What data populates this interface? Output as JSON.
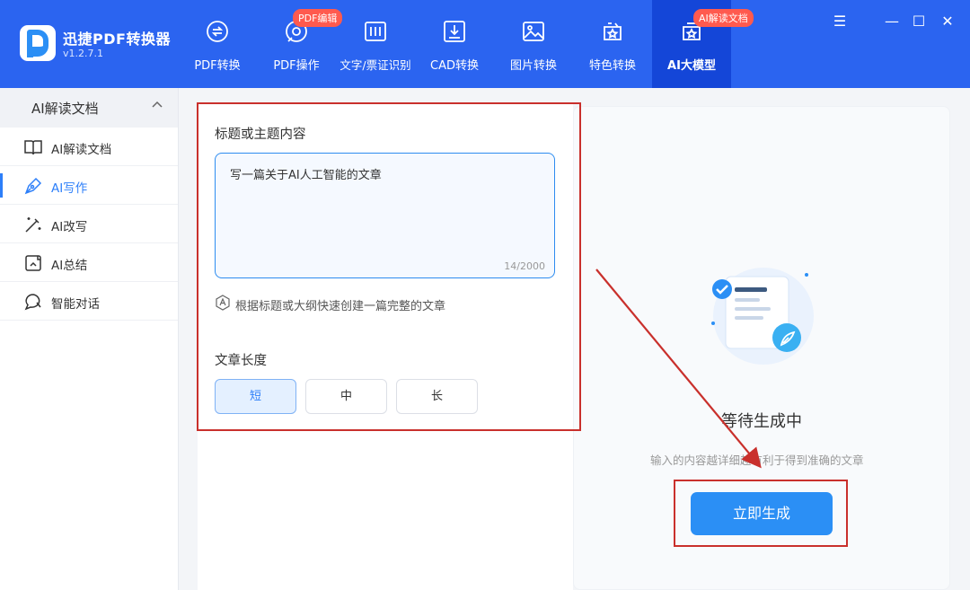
{
  "app": {
    "name": "迅捷PDF转换器",
    "version": "v1.2.7.1"
  },
  "nav": [
    {
      "label": "PDF转换",
      "icon": "pdf-convert-icon"
    },
    {
      "label": "PDF操作",
      "icon": "pdf-operate-icon",
      "badge": "PDF编辑"
    },
    {
      "label": "文字/票证识别",
      "icon": "ocr-icon"
    },
    {
      "label": "CAD转换",
      "icon": "cad-icon"
    },
    {
      "label": "图片转换",
      "icon": "image-icon"
    },
    {
      "label": "特色转换",
      "icon": "special-convert-icon"
    },
    {
      "label": "AI大模型",
      "icon": "ai-model-icon",
      "badge": "AI解读文档",
      "active": true
    }
  ],
  "sidebar": {
    "header": "AI解读文档",
    "items": [
      {
        "label": "AI解读文档",
        "icon": "book-icon"
      },
      {
        "label": "AI写作",
        "icon": "pen-icon",
        "active": true
      },
      {
        "label": "AI改写",
        "icon": "magic-wand-icon"
      },
      {
        "label": "AI总结",
        "icon": "summary-icon"
      },
      {
        "label": "智能对话",
        "icon": "chat-icon"
      }
    ]
  },
  "form": {
    "title_label": "标题或主题内容",
    "title_value": "写一篇关于AI人工智能的文章",
    "char_count": "14/2000",
    "hint": "根据标题或大纲快速创建一篇完整的文章",
    "length_label": "文章长度",
    "length_options": [
      "短",
      "中",
      "长"
    ],
    "length_selected": "短"
  },
  "result": {
    "status": "等待生成中",
    "sub": "输入的内容越详细越有利于得到准确的文章",
    "generate_button": "立即生成"
  },
  "colors": {
    "header": "#2b64f0",
    "header_active": "#1446d8",
    "accent": "#2b8ff5",
    "badge": "#ff5a4e",
    "annotation": "#c9302c"
  }
}
